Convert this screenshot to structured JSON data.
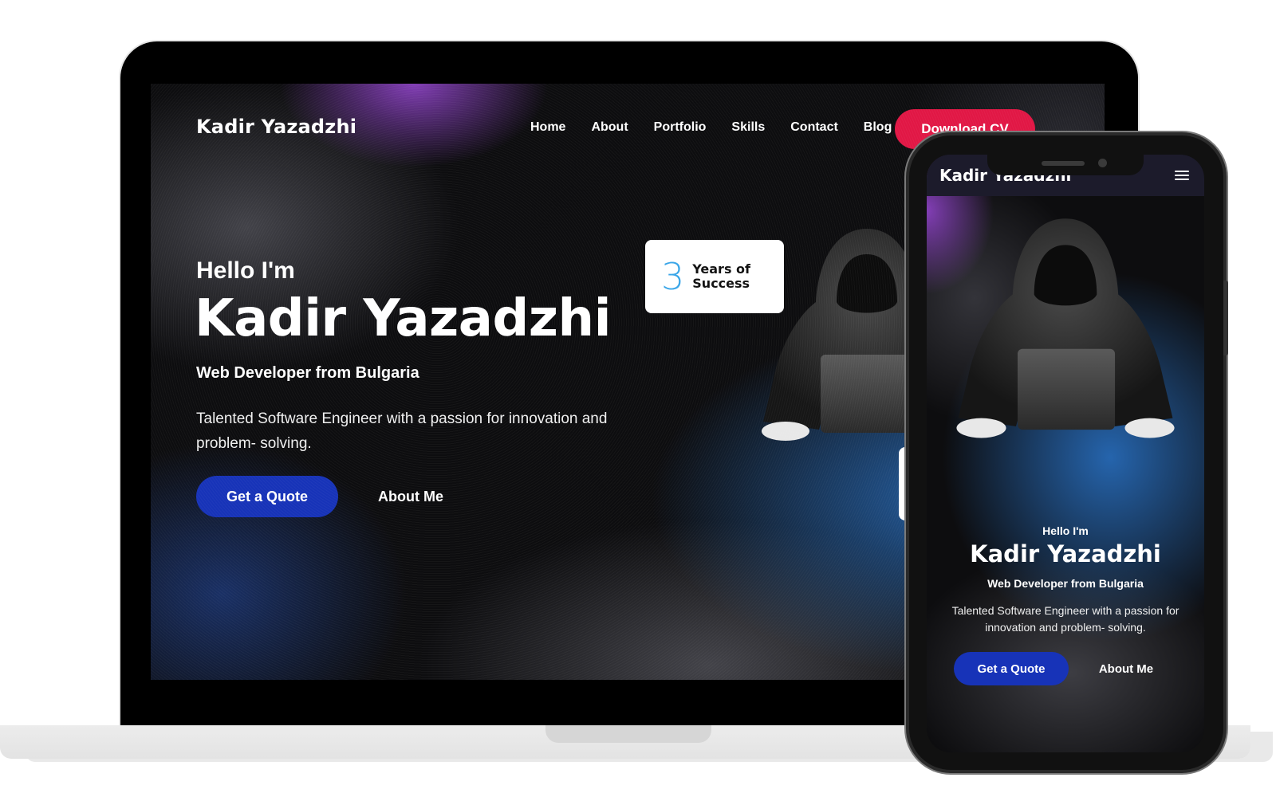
{
  "desktop": {
    "brand": "Kadir Yazadzhi",
    "nav": [
      "Home",
      "About",
      "Portfolio",
      "Skills",
      "Contact",
      "Blog"
    ],
    "cta": "Download CV",
    "hero": {
      "greeting": "Hello I'm",
      "name": "Kadir Yazadzhi",
      "subtitle": "Web Developer from Bulgaria",
      "description": "Talented Software Engineer with a passion for innovation and problem- solving.",
      "primary_button": "Get a Quote",
      "secondary_button": "About Me"
    },
    "stat": {
      "number": "3",
      "label": "Years of Success"
    }
  },
  "mobile": {
    "brand": "Kadir Yazadzhi",
    "hero": {
      "greeting": "Hello I'm",
      "name": "Kadir Yazadzhi",
      "subtitle": "Web Developer from Bulgaria",
      "description": "Talented Software Engineer with a passion for innovation and problem- solving.",
      "primary_button": "Get a Quote",
      "secondary_button": "About Me"
    }
  },
  "colors": {
    "accent_red": "#e11745",
    "primary_blue": "#1733b8",
    "stat_blue": "#38a5e8"
  },
  "icons": {
    "menu": "hamburger-menu-icon"
  }
}
